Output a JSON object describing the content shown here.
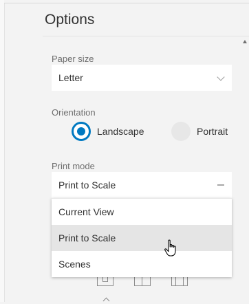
{
  "panel": {
    "title": "Options"
  },
  "paper_size": {
    "label": "Paper size",
    "value": "Letter",
    "icon": "chevron-down-icon"
  },
  "orientation": {
    "label": "Orientation",
    "options": [
      {
        "label": "Landscape",
        "selected": true
      },
      {
        "label": "Portrait",
        "selected": false
      }
    ]
  },
  "print_mode": {
    "label": "Print mode",
    "value": "Print to Scale",
    "icon": "collapse-icon",
    "options": [
      {
        "label": "Current View",
        "highlighted": false
      },
      {
        "label": "Print to Scale",
        "highlighted": true
      },
      {
        "label": "Scenes",
        "highlighted": false
      }
    ]
  },
  "layout_icons": [
    "single-frame-icon",
    "split-two-icon",
    "split-three-icon"
  ],
  "colors": {
    "accent": "#0079c1",
    "background": "#f3f3f3",
    "highlight": "#e5e5e5"
  }
}
